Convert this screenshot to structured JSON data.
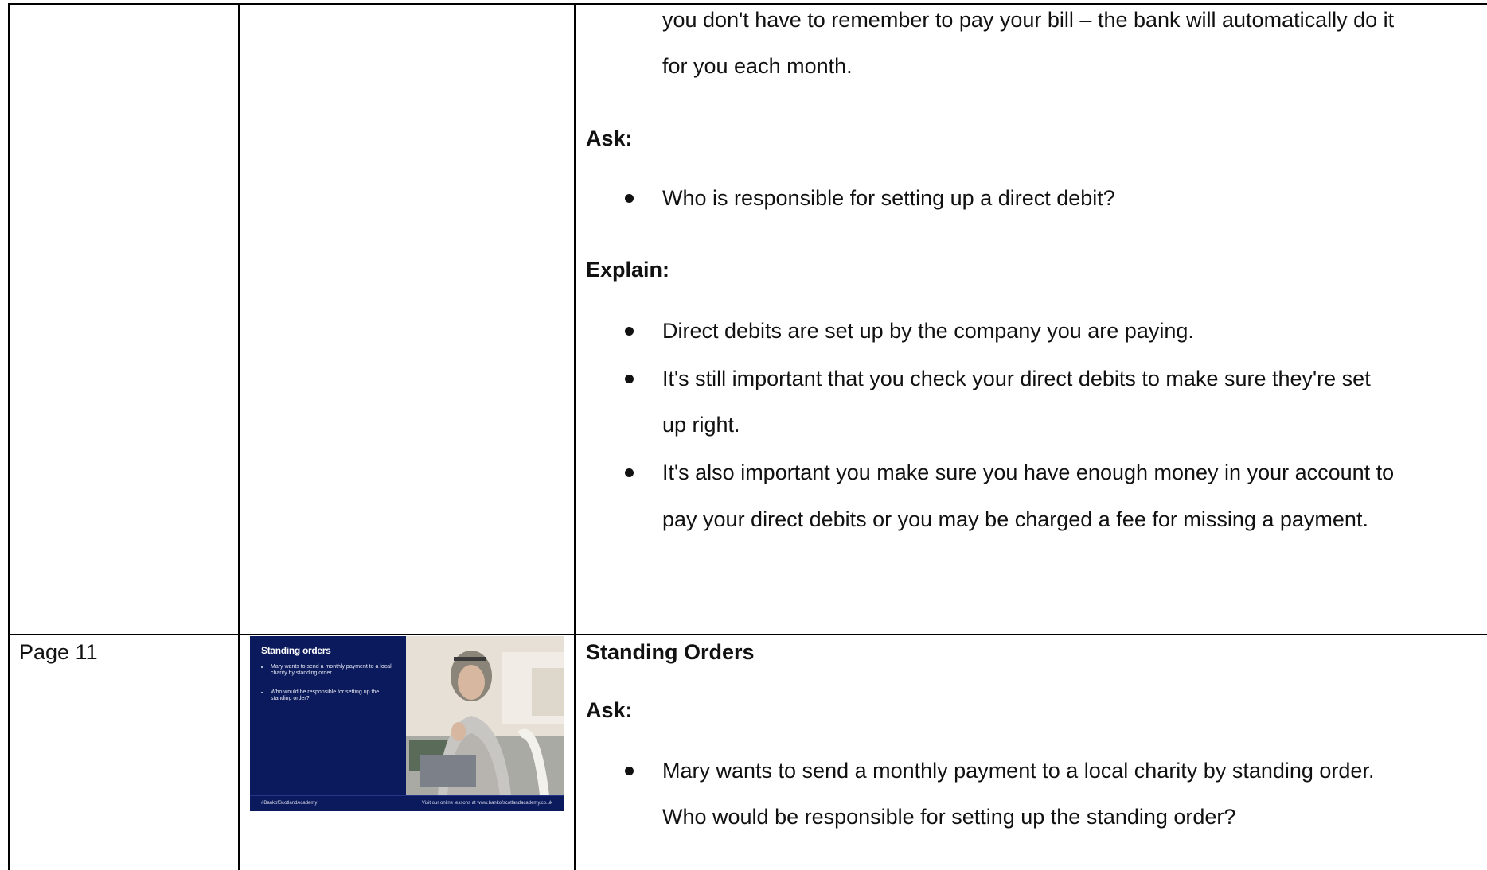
{
  "top_row": {
    "continued_bullet_line1": "you don't have to remember to pay your bill – the bank will automatically do it",
    "continued_bullet_line2": "for you each month.",
    "ask_heading": "Ask:",
    "ask_bullet": "Who is responsible for setting up a direct debit?",
    "explain_heading": "Explain:",
    "explain_bullets": [
      {
        "lines": [
          "Direct debits are set up by the company you are paying."
        ]
      },
      {
        "lines": [
          "It's still important that you check your direct debits to make sure they're set",
          "up right."
        ]
      },
      {
        "lines": [
          "It's also important you make sure you have enough money in your account to",
          "pay your direct debits or you may be charged a fee for missing a payment."
        ]
      }
    ]
  },
  "bottom_row": {
    "page_label": "Page 11",
    "slide": {
      "title": "Standing orders",
      "bullets": [
        "Mary wants to send a monthly payment to a local charity by standing order.",
        "Who would be responsible for setting up the standing order?"
      ],
      "footer_left": "#BankofScotlandAcademy",
      "footer_right": "Visit our online lessons at www.bankofscotlandacademy.co.uk"
    },
    "section_heading": "Standing Orders",
    "ask_heading": "Ask:",
    "ask_bullet_line1": "Mary wants to send a monthly payment to a local charity by standing order.",
    "ask_bullet_line2": "Who would be responsible for setting up the standing order?"
  }
}
